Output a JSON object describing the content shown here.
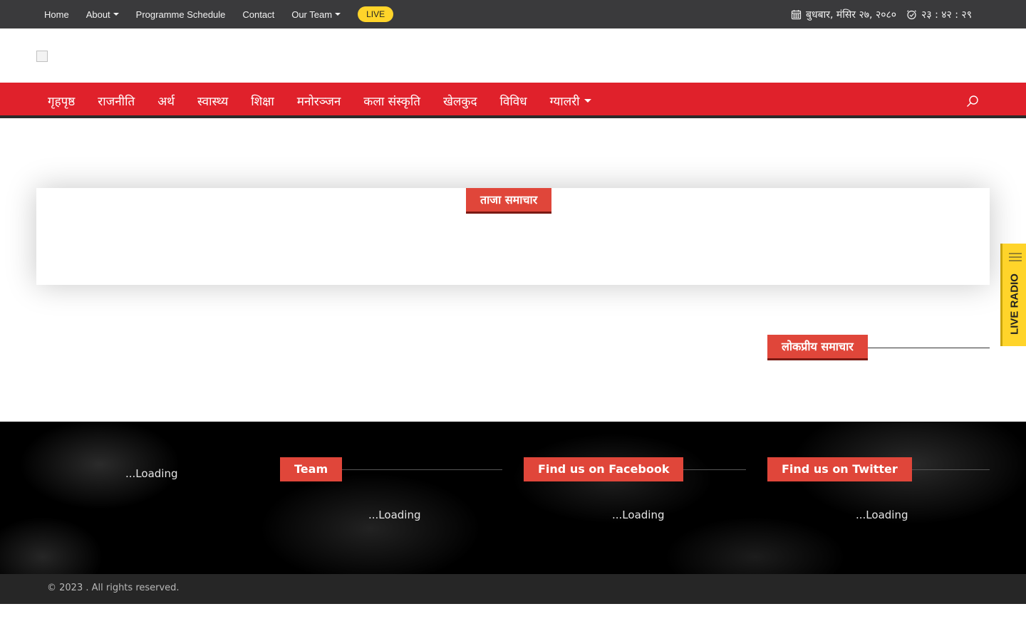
{
  "topbar": {
    "nav": [
      {
        "label": "Home",
        "dropdown": false
      },
      {
        "label": "About",
        "dropdown": true
      },
      {
        "label": "Programme Schedule",
        "dropdown": false
      },
      {
        "label": "Contact",
        "dropdown": false
      },
      {
        "label": "Our Team",
        "dropdown": true
      }
    ],
    "live_label": "LIVE",
    "date": "बुधबार, मंसिर २७, २०८०",
    "time": "२३ : ४२ : २९",
    "calendar_icon": "calendar-icon",
    "clock_icon": "clock-icon"
  },
  "mainnav": {
    "items": [
      {
        "label": "गृहपृष्ठ",
        "dropdown": false
      },
      {
        "label": "राजनीति",
        "dropdown": false
      },
      {
        "label": "अर्थ",
        "dropdown": false
      },
      {
        "label": "स्वास्थ्य",
        "dropdown": false
      },
      {
        "label": "शिक्षा",
        "dropdown": false
      },
      {
        "label": "मनोरञ्जन",
        "dropdown": false
      },
      {
        "label": "कला संस्कृति",
        "dropdown": false
      },
      {
        "label": "खेलकुद",
        "dropdown": false
      },
      {
        "label": "विविध",
        "dropdown": false
      },
      {
        "label": "ग्यालरी",
        "dropdown": true
      }
    ],
    "search_icon": "search-icon"
  },
  "breaking": {
    "title": "ताजा समाचार"
  },
  "popular": {
    "title": "लोकप्रीय समाचार"
  },
  "live_radio": {
    "label": "LIVE RADIO"
  },
  "footer": {
    "col1_loading": "...Loading",
    "team": {
      "title": "Team",
      "loading": "...Loading"
    },
    "facebook": {
      "title": "Find us on Facebook",
      "loading": "...Loading"
    },
    "twitter": {
      "title": "Find us on Twitter",
      "loading": "...Loading"
    }
  },
  "copyright": "© 2023 . All rights reserved.",
  "colors": {
    "topbar": "#3a3a3c",
    "nav_red": "#e0212b",
    "tag_red": "#e0463a",
    "live_yellow": "#ffd42a"
  }
}
